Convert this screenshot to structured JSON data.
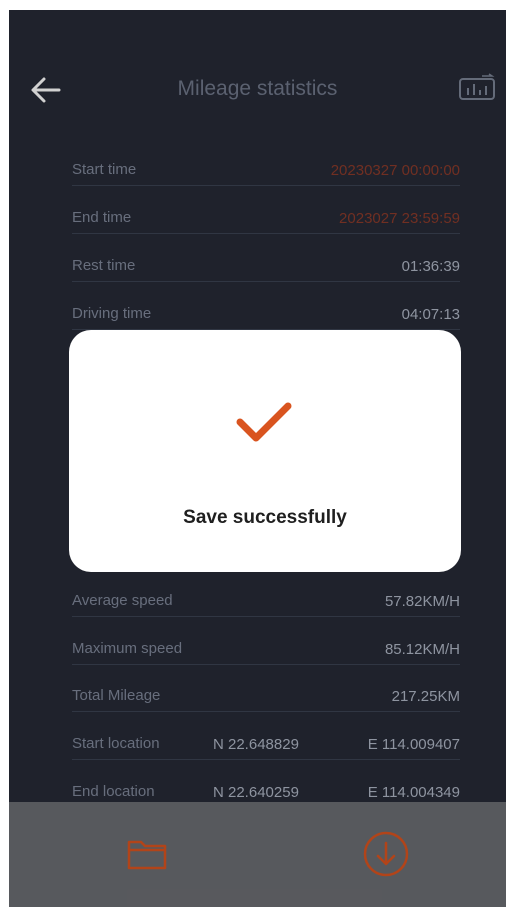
{
  "header": {
    "title": "Mileage statistics",
    "back_icon": "arrow-left-icon",
    "chart_icon": "bar-chart-icon"
  },
  "stats": [
    {
      "label": "Start time",
      "value": "20230327 00:00:00"
    },
    {
      "label": "End time",
      "value": "2023027  23:59:59"
    },
    {
      "label": "Rest time",
      "value": "01:36:39"
    },
    {
      "label": "Driving time",
      "value": "04:07:13"
    },
    {
      "label": "Average speed",
      "value": "57.82KM/H"
    },
    {
      "label": "Maximum speed",
      "value": "85.12KM/H"
    },
    {
      "label": "Total Mileage",
      "value": "217.25KM"
    },
    {
      "label": "Start location",
      "lat": "N 22.648829",
      "lon": "E 114.009407"
    },
    {
      "label": "End location",
      "lat": "N 22.640259",
      "lon": "E 114.004349"
    }
  ],
  "dialog": {
    "message": "Save successfully",
    "icon": "checkmark-icon"
  },
  "bottom_bar": {
    "left_icon": "folder-icon",
    "right_icon": "download-circle-icon"
  },
  "colors": {
    "background": "#262a36",
    "accent": "#d9541f",
    "highlight_value": "#8a3a2a"
  }
}
